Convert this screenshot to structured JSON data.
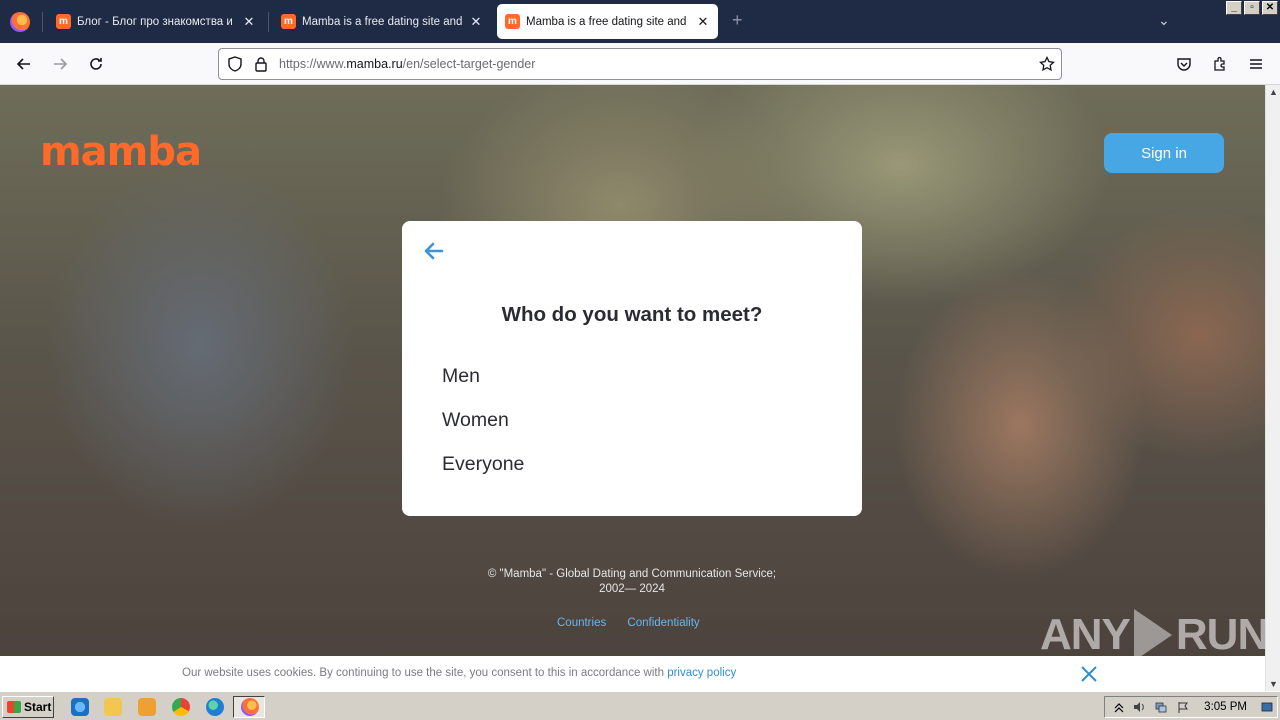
{
  "browser": {
    "tabs": [
      {
        "title": "Блог - Блог про знакомства и отн",
        "close": "✕"
      },
      {
        "title": "Mamba is a free dating site and a c",
        "close": "✕"
      },
      {
        "title": "Mamba is a free dating site and a c",
        "close": "✕",
        "active": true
      }
    ],
    "new_tab": "+",
    "tab_list": "⌄",
    "url_prefix": "https://www.",
    "url_domain": "mamba.ru",
    "url_path": "/en/select-target-gender",
    "window_buttons": [
      "_",
      "▫",
      "✕"
    ]
  },
  "page": {
    "logo": "mamba",
    "sign_in": "Sign in",
    "card": {
      "title": "Who do you want to meet?",
      "options": [
        "Men",
        "Women",
        "Everyone"
      ]
    },
    "copyright_line1": "© \"Mamba\" - Global Dating and Communication Service;",
    "copyright_line2": "2002— 2024",
    "footer_links": [
      "Countries",
      "Confidentiality"
    ],
    "cookie": {
      "text": "Our website uses cookies. By continuing to use the site, you consent to this in accordance with ",
      "link": "privacy policy"
    },
    "watermark_left": "ANY",
    "watermark_right": "RUN"
  },
  "taskbar": {
    "start": "Start",
    "clock": "3:05 PM"
  },
  "colors": {
    "brand": "#ff6a2a",
    "accent": "#47a6e4",
    "tabstrip": "#1f2a44"
  }
}
